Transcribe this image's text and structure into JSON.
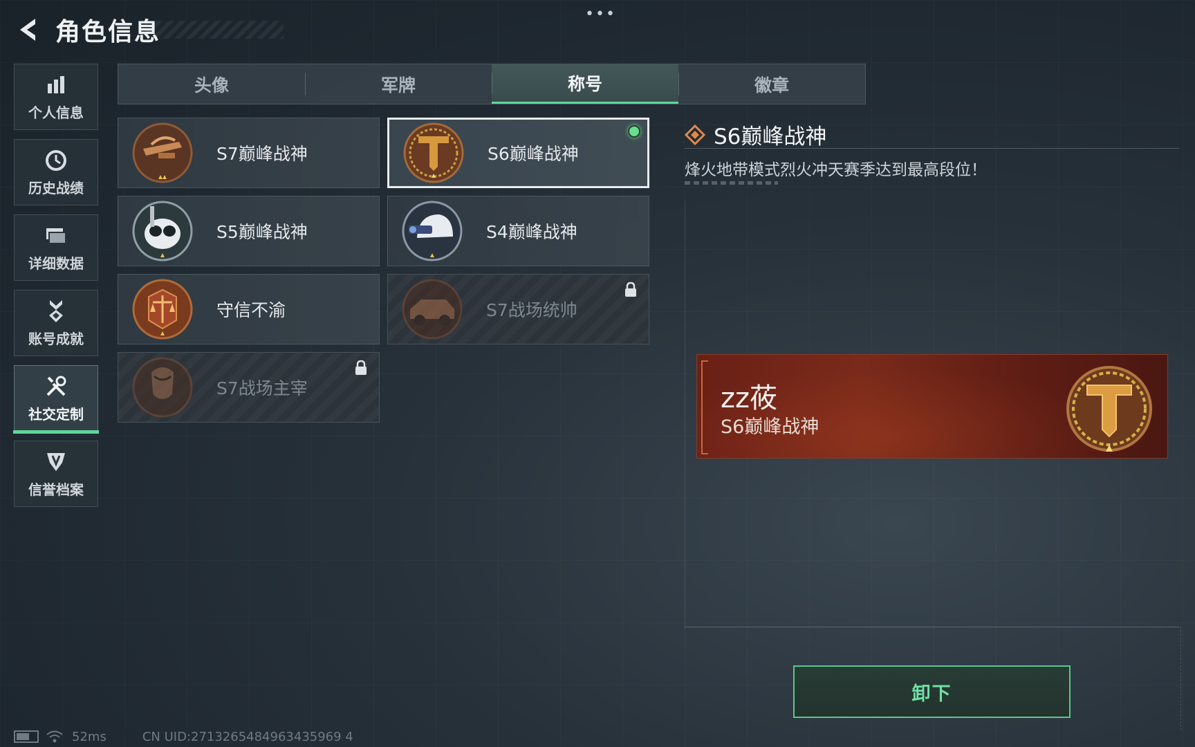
{
  "header": {
    "title": "角色信息",
    "more": "•••"
  },
  "sidebar": {
    "items": [
      {
        "label": "个人信息",
        "icon": "bar-chart-icon"
      },
      {
        "label": "历史战绩",
        "icon": "history-clock-icon"
      },
      {
        "label": "详细数据",
        "icon": "folder-icon"
      },
      {
        "label": "账号成就",
        "icon": "medal-icon"
      },
      {
        "label": "社交定制",
        "icon": "tools-icon",
        "active": true
      },
      {
        "label": "信誉档案",
        "icon": "shield-badge-icon"
      }
    ]
  },
  "tabs": [
    {
      "label": "头像"
    },
    {
      "label": "军牌"
    },
    {
      "label": "称号",
      "active": true
    },
    {
      "label": "徽章"
    }
  ],
  "titles": [
    {
      "name": "S7巅峰战神",
      "emblem": "crossbow-emblem-icon"
    },
    {
      "name": "S6巅峰战神",
      "emblem": "t-shield-emblem-icon",
      "selected": true,
      "equipped": true
    },
    {
      "name": "S5巅峰战神",
      "emblem": "diving-mask-emblem-icon"
    },
    {
      "name": "S4巅峰战神",
      "emblem": "helmet-emblem-icon"
    },
    {
      "name": "守信不渝",
      "emblem": "scales-emblem-icon"
    },
    {
      "name": "S7战场统帅",
      "emblem": "vehicle-emblem-icon",
      "locked": true
    },
    {
      "name": "S7战场主宰",
      "emblem": "warrior-emblem-icon",
      "locked": true
    }
  ],
  "detail": {
    "name": "S6巅峰战神",
    "description": "烽火地带模式烈火冲天赛季达到最高段位！"
  },
  "preview": {
    "player_name": "zz莜",
    "title": "S6巅峰战神"
  },
  "actions": {
    "unequip_label": "卸下"
  },
  "status": {
    "ping": "52ms",
    "uid": "CN UID:2713265484963435969 4"
  },
  "colors": {
    "accent": "#5fd79b",
    "equipped_dot": "#66e08f",
    "emblem_bronze": "#b5713a",
    "preview_red": "#6a2016"
  }
}
